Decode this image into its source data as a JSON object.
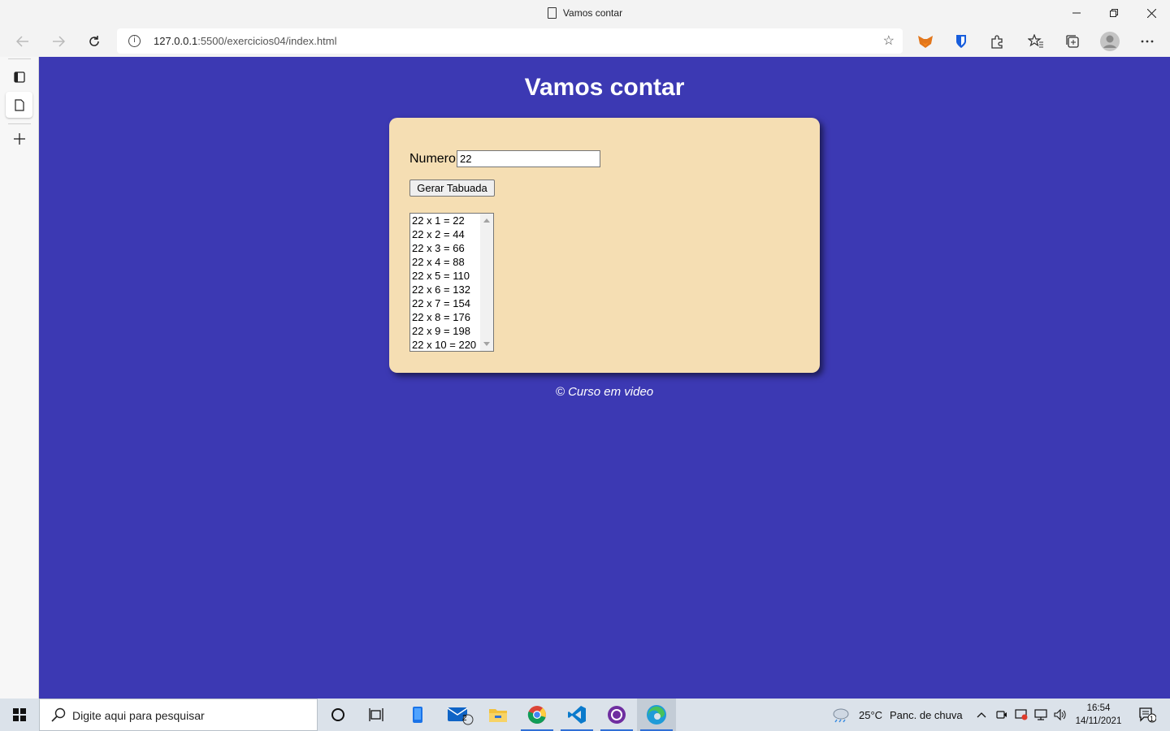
{
  "browser": {
    "tab_title": "Vamos contar",
    "url_host": "127.0.0.1",
    "url_rest": ":5500/exercicios04/index.html"
  },
  "page": {
    "heading": "Vamos contar",
    "number_label": "Numero",
    "number_value": "22",
    "button_label": "Gerar Tabuada",
    "results": [
      "22 x 1 = 22",
      "22 x 2 = 44",
      "22 x 3 = 66",
      "22 x 4 = 88",
      "22 x 5 = 110",
      "22 x 6 = 132",
      "22 x 7 = 154",
      "22 x 8 = 176",
      "22 x 9 = 198",
      "22 x 10 = 220"
    ],
    "footer": "© Curso em video"
  },
  "taskbar": {
    "search_placeholder": "Digite aqui para pesquisar",
    "mail_badge": "2",
    "weather_temp": "25°C",
    "weather_text": "Panc. de chuva",
    "time": "16:54",
    "date": "14/11/2021",
    "notification_count": "1"
  },
  "colors": {
    "page_background": "#3c39b3",
    "card_background": "#f5deb3"
  }
}
